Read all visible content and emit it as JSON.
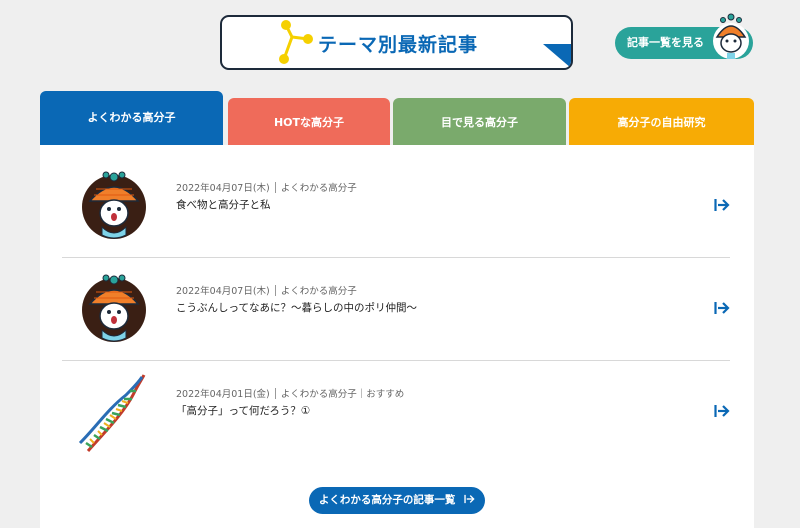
{
  "header": {
    "title": "テーマ別最新記事",
    "list_button_label": "記事一覧を見る"
  },
  "tabs": [
    {
      "label": "よくわかる高分子",
      "active": true,
      "color": "#0a68b5"
    },
    {
      "label": "HOTな高分子",
      "active": false,
      "color": "#ef6b5a"
    },
    {
      "label": "目で見る高分子",
      "active": false,
      "color": "#7aaa6c"
    },
    {
      "label": "高分子の自由研究",
      "active": false,
      "color": "#f7ab05"
    }
  ],
  "articles": [
    {
      "date": "2022年04月07日(木)",
      "categories": "よくわかる高分子",
      "title": "食べ物と高分子と私",
      "thumb": "mascot-icon"
    },
    {
      "date": "2022年04月07日(木)",
      "categories": "よくわかる高分子",
      "title": "こうぶんしってなあに？〜暮らしの中のポリ仲間〜",
      "thumb": "mascot-icon"
    },
    {
      "date": "2022年04月01日(金)",
      "categories": "よくわかる高分子｜おすすめ",
      "title": "「高分子」って何だろう？①",
      "thumb": "dna-helix-icon"
    }
  ],
  "more_button_label": "よくわかる高分子の記事一覧",
  "colors": {
    "primary": "#0a68b5",
    "teal": "#2aa39a",
    "background": "#efefef"
  }
}
